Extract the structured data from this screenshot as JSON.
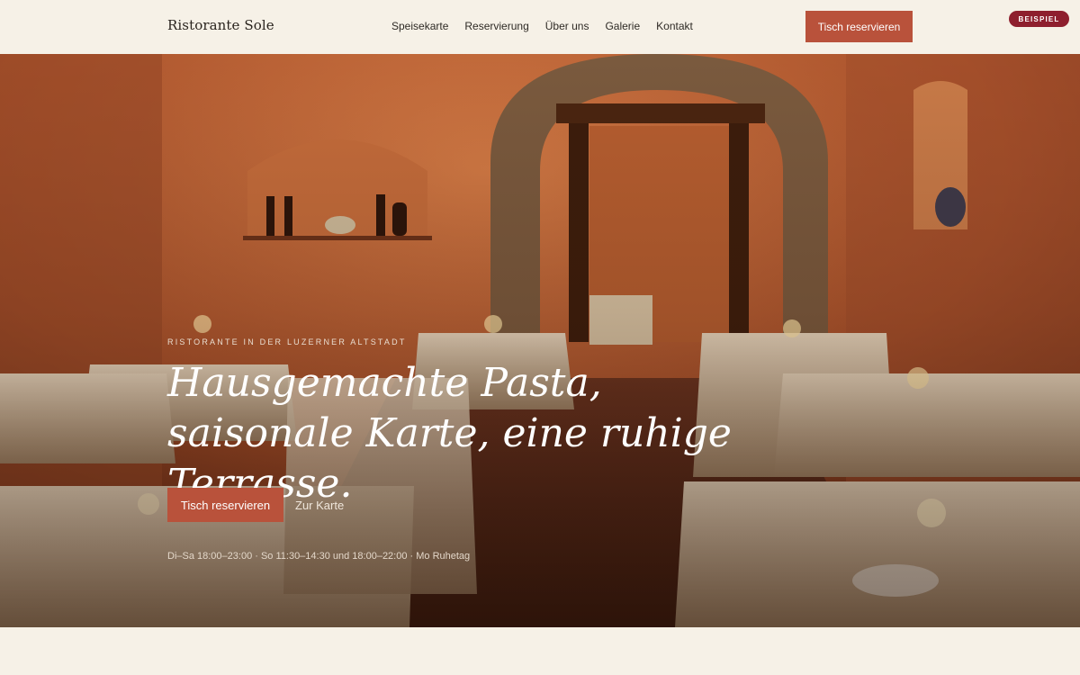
{
  "header": {
    "logo": "Ristorante Sole",
    "nav": [
      "Speisekarte",
      "Reservierung",
      "Über uns",
      "Galerie",
      "Kontakt"
    ],
    "cta_label": "Tisch reservieren",
    "badge": "BEISPIEL"
  },
  "hero": {
    "eyebrow": "RISTORANTE IN DER LUZERNER ALTSTADT",
    "headline": "Hausgemachte Pasta, saisonale Karte, eine ruhige Terrasse.",
    "primary_cta": "Tisch reservieren",
    "secondary_cta": "Zur Karte",
    "hours": "Di–Sa 18:00–23:00 · So 11:30–14:30 und 18:00–22:00 · Mo Ruhetag"
  },
  "colors": {
    "accent": "#b9523b",
    "badge": "#8e1f2e",
    "background": "#f6f1e7"
  }
}
